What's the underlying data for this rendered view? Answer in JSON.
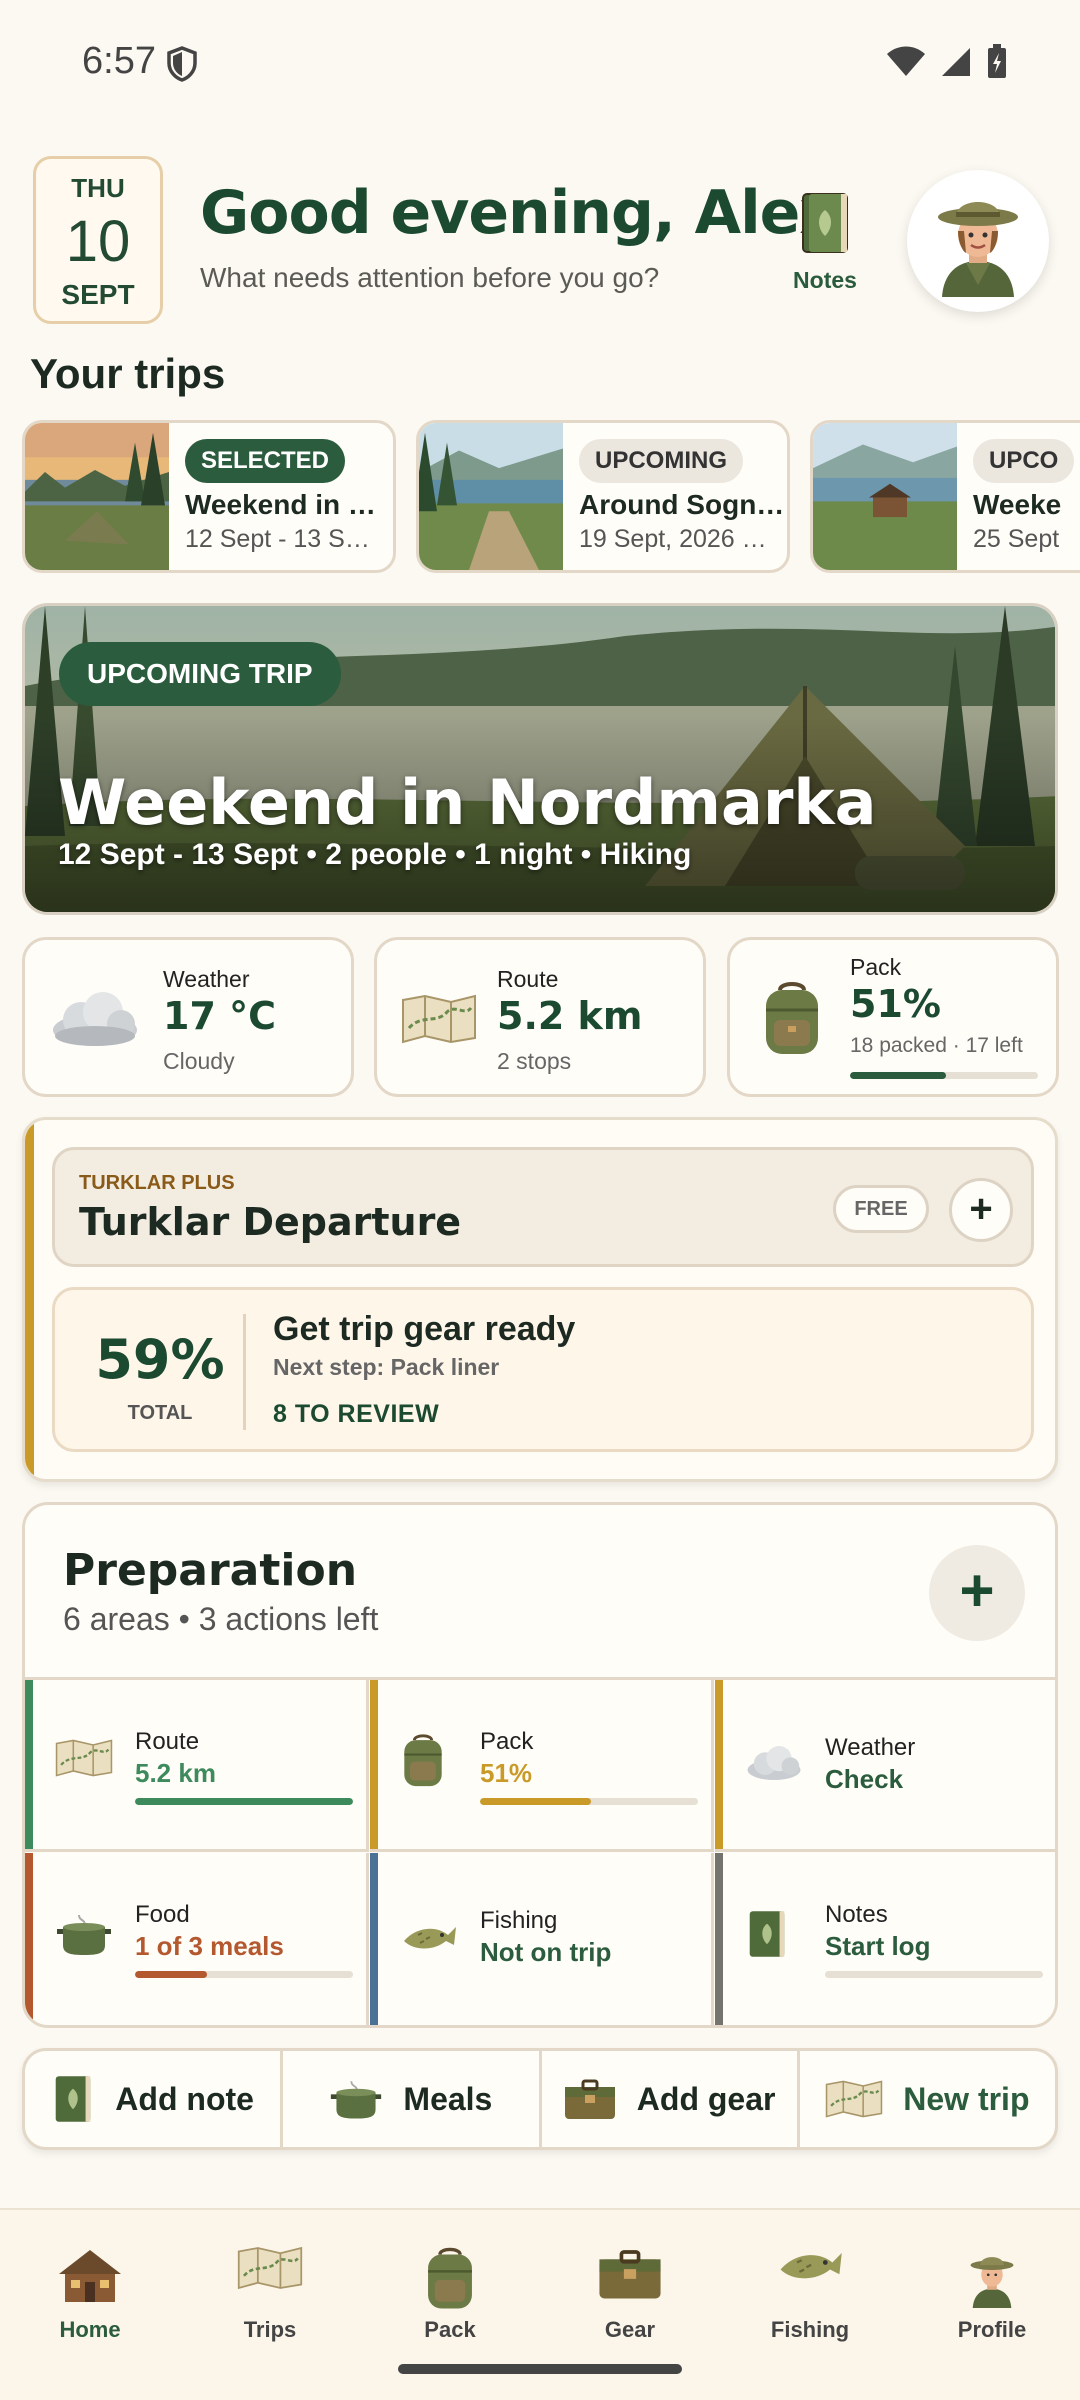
{
  "status_bar": {
    "time": "6:57"
  },
  "header": {
    "date": {
      "dow": "THU",
      "day": "10",
      "month": "SEPT"
    },
    "greeting": "Good evening, Alex",
    "subtitle": "What needs attention before you go?",
    "notes_label": "Notes"
  },
  "trips_section": {
    "title": "Your trips",
    "trips": [
      {
        "badge": "SELECTED",
        "name": "Weekend in …",
        "dates": "12 Sept - 13 S…"
      },
      {
        "badge": "UPCOMING",
        "name": "Around Sogn…",
        "dates": "19 Sept, 2026 …"
      },
      {
        "badge": "UPCO",
        "name": "Weeke",
        "dates": "25 Sept"
      }
    ]
  },
  "hero": {
    "badge": "UPCOMING TRIP",
    "title": "Weekend in Nordmarka",
    "subtitle": "12 Sept - 13 Sept • 2 people • 1 night • Hiking"
  },
  "stats": {
    "weather": {
      "label": "Weather",
      "value": "17 °C",
      "sub": "Cloudy"
    },
    "route": {
      "label": "Route",
      "value": "5.2 km",
      "sub": "2 stops"
    },
    "pack": {
      "label": "Pack",
      "value": "51%",
      "sub": "18 packed · 17 left",
      "progress": 0.51
    }
  },
  "turklar": {
    "kicker": "TURKLAR PLUS",
    "title": "Turklar Departure",
    "free": "FREE",
    "percent": "59%",
    "percent_label": "TOTAL",
    "card_title": "Get trip gear ready",
    "next_step": "Next step: Pack liner",
    "review": "8 TO REVIEW"
  },
  "preparation": {
    "title": "Preparation",
    "subtitle": "6 areas • 3 actions left",
    "areas": [
      {
        "label": "Route",
        "value": "5.2 km",
        "progress": 1.0,
        "color": "#3d8a5c"
      },
      {
        "label": "Pack",
        "value": "51%",
        "progress": 0.51,
        "color": "#c99a28"
      },
      {
        "label": "Weather",
        "value": "Check",
        "color": "#c99a28"
      },
      {
        "label": "Food",
        "value": "1 of 3 meals",
        "progress": 0.33,
        "color": "#b4582f"
      },
      {
        "label": "Fishing",
        "value": "Not on trip",
        "color": "#4a7196"
      },
      {
        "label": "Notes",
        "value": "Start log",
        "progress": 0.0,
        "color": "#74736e"
      }
    ]
  },
  "quick_actions": {
    "add_note": "Add note",
    "meals": "Meals",
    "add_gear": "Add gear",
    "new_trip": "New trip"
  },
  "nav": {
    "home": "Home",
    "trips": "Trips",
    "pack": "Pack",
    "gear": "Gear",
    "fishing": "Fishing",
    "profile": "Profile"
  }
}
